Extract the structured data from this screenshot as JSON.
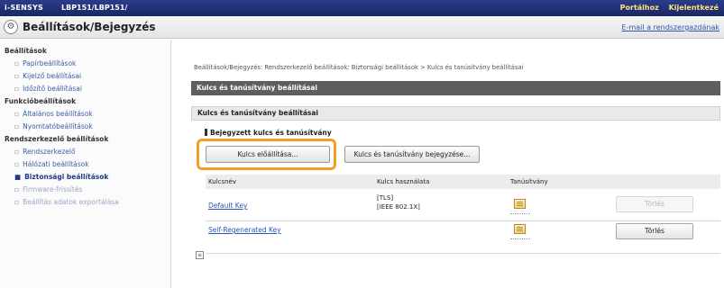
{
  "topbar": {
    "brand": "i-SENSYS",
    "model": "LBP151/LBP151/",
    "links": [
      "Portálhoz",
      "Kijelentkezé"
    ]
  },
  "titlebar": {
    "title": "Beállítások/Bejegyzés",
    "mail_link": "E-mail a rendszergazdának"
  },
  "sidebar": {
    "group_settings": "Beállítások",
    "items_settings": [
      "Papírbeállítások",
      "Kijelző beállításai",
      "Időzítő beállításai"
    ],
    "group_function": "Funkcióbeállítások",
    "items_function": [
      "Általános beállítások",
      "Nyomtatóbeállítások"
    ],
    "group_admin": "Rendszerkezelő beállítások",
    "items_admin": [
      "Rendszerkezelő",
      "Hálózati beállítások",
      "Biztonsági beállítások",
      "Firmware-frissítés",
      "Beállítás adatok exportálása"
    ]
  },
  "main": {
    "breadcrumb": "Beállítások/Bejegyzés: Rendszerkezelő beállítások: Biztonsági beállítások > Kulcs és tanúsítvány beállításai",
    "header": "Kulcs és tanúsítvány beállításai",
    "subheader": "Kulcs és tanúsítvány beállításai",
    "section_title": "Bejegyzett kulcs és tanúsítvány",
    "btn_generate": "Kulcs előállítása...",
    "btn_register": "Kulcs és tanúsítvány bejegyzése...",
    "columns": [
      "Kulcsnév",
      "Kulcs használata",
      "Tanúsítvány"
    ],
    "rows": [
      {
        "name": "Default Key",
        "usage1": "[TLS]",
        "usage2": "[IEEE 802.1X]",
        "delete": "Törlés"
      },
      {
        "name": "Self-Regenerated Key",
        "usage1": "",
        "usage2": "",
        "delete": "Törlés"
      }
    ]
  }
}
